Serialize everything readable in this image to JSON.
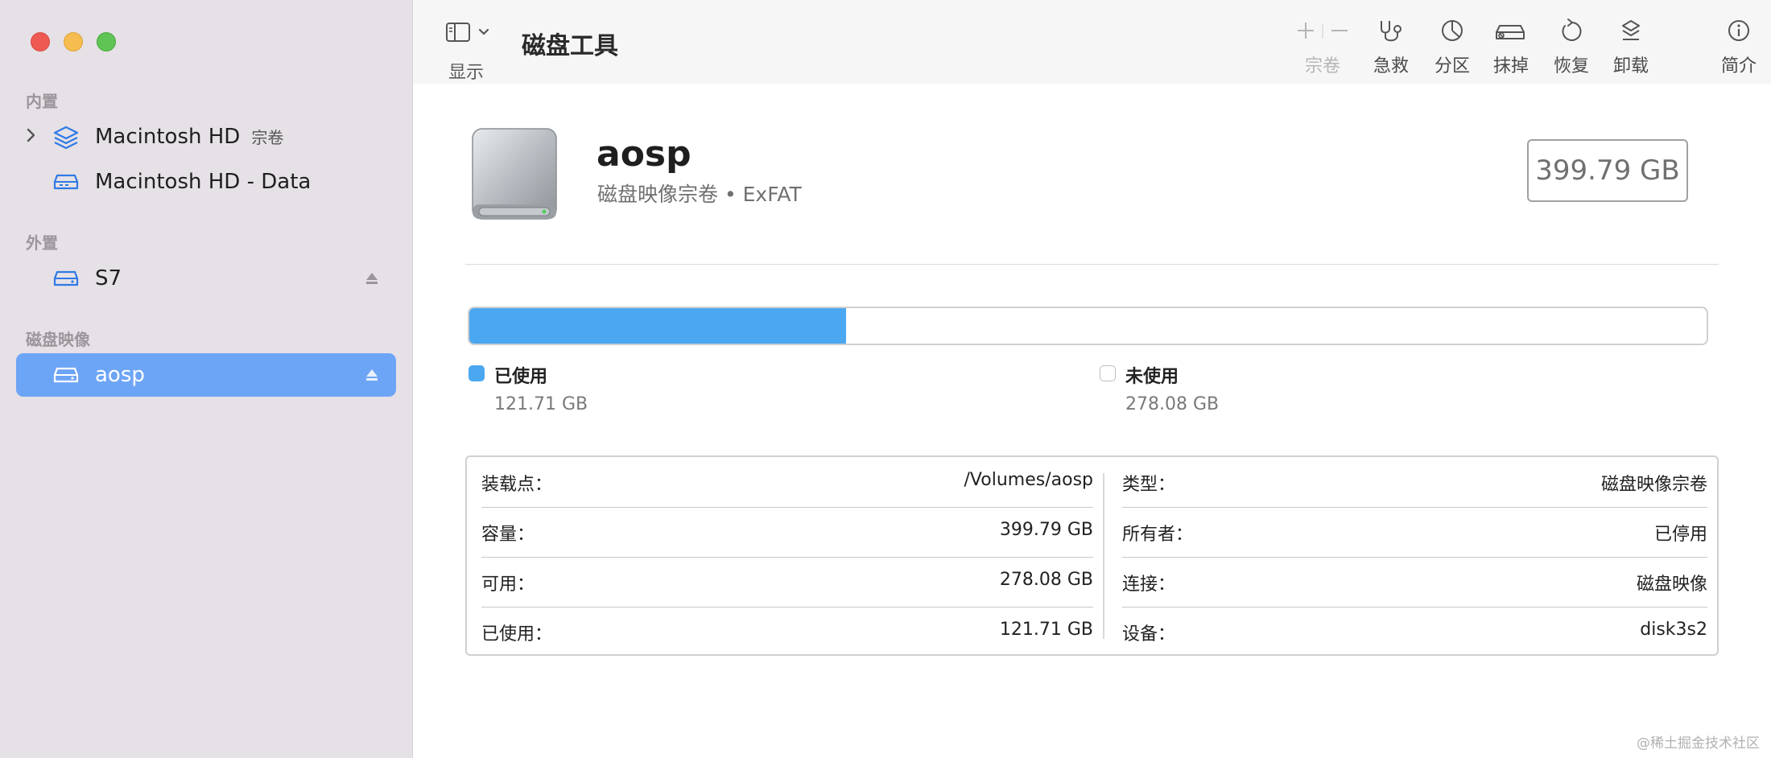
{
  "sidebar": {
    "sections": [
      {
        "title": "内置"
      },
      {
        "title": "外置"
      },
      {
        "title": "磁盘映像"
      }
    ],
    "items": [
      {
        "label": "Macintosh HD",
        "sublabel": "宗卷",
        "icon": "layers-icon"
      },
      {
        "label": "Macintosh HD - Data",
        "icon": "drive-icon"
      },
      {
        "label": "S7",
        "icon": "drive-icon",
        "eject": true
      },
      {
        "label": "aosp",
        "icon": "drive-icon",
        "eject": true,
        "selected": true
      }
    ]
  },
  "toolbar": {
    "view_label": "显示",
    "title": "磁盘工具",
    "buttons": [
      {
        "label": "宗卷",
        "icon": "plus-minus-icon",
        "disabled": true
      },
      {
        "label": "急救",
        "icon": "stethoscope-icon"
      },
      {
        "label": "分区",
        "icon": "pie-icon"
      },
      {
        "label": "抹掉",
        "icon": "erase-drive-icon"
      },
      {
        "label": "恢复",
        "icon": "restore-icon"
      },
      {
        "label": "卸载",
        "icon": "unmount-icon"
      },
      {
        "label": "简介",
        "icon": "info-icon"
      }
    ]
  },
  "disk": {
    "name": "aosp",
    "subtitle": "磁盘映像宗卷 • ExFAT",
    "capacity": "399.79 GB"
  },
  "usage": {
    "used_fraction": 0.3044,
    "colors": {
      "used": "#4aa7f0",
      "free": "#ffffff"
    },
    "used": {
      "label": "已使用",
      "value": "121.71 GB"
    },
    "free": {
      "label": "未使用",
      "value": "278.08 GB"
    }
  },
  "info": {
    "left": [
      {
        "key": "装载点：",
        "value": "/Volumes/aosp"
      },
      {
        "key": "容量：",
        "value": "399.79 GB"
      },
      {
        "key": "可用：",
        "value": "278.08 GB"
      },
      {
        "key": "已使用：",
        "value": "121.71 GB"
      }
    ],
    "right": [
      {
        "key": "类型：",
        "value": "磁盘映像宗卷"
      },
      {
        "key": "所有者：",
        "value": "已停用"
      },
      {
        "key": "连接：",
        "value": "磁盘映像"
      },
      {
        "key": "设备：",
        "value": "disk3s2"
      }
    ]
  },
  "watermark": "@稀土掘金技术社区"
}
